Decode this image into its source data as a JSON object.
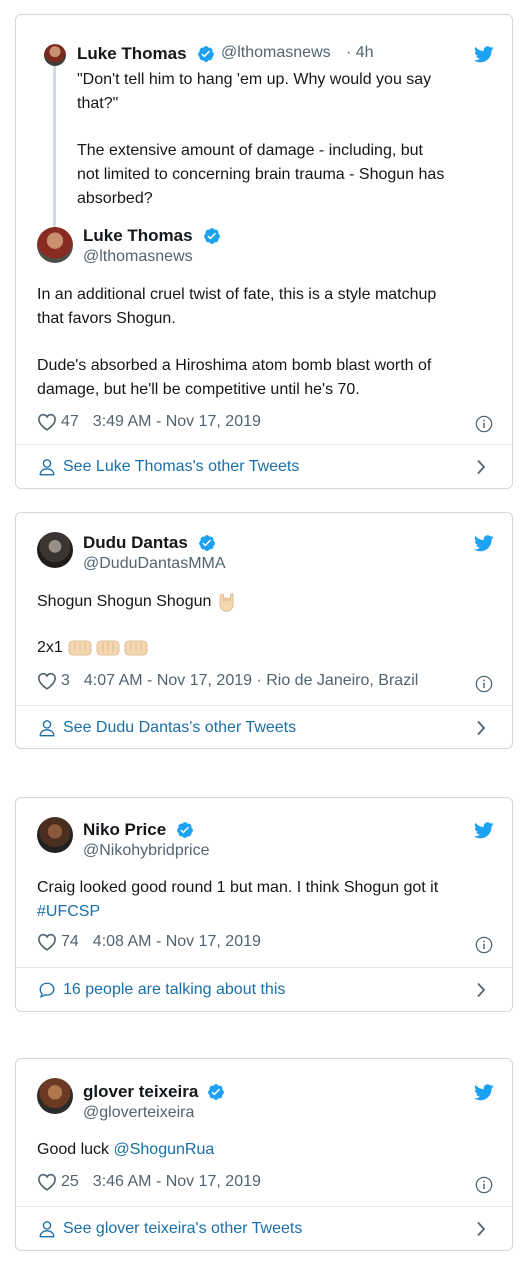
{
  "tweets": [
    {
      "quote": {
        "name": "Luke Thomas",
        "handle": "@lthomasnews",
        "time": "· 4h",
        "line1": "\"Don't tell him to hang 'em up. Why would you say",
        "line2": "that?\"",
        "line3": "The extensive amount of damage - including, but",
        "line4": "not limited to concerning brain trauma - Shogun has",
        "line5": "absorbed?"
      },
      "name": "Luke Thomas",
      "handle": "@lthomasnews",
      "line1": "In an additional cruel twist of fate, this is a style matchup",
      "line2": "that favors Shogun.",
      "line3": "Dude's absorbed a Hiroshima atom bomb blast worth of",
      "line4": "damage, but he'll be competitive until he's 70.",
      "likes": "47",
      "timestamp": "3:49 AM - Nov 17, 2019",
      "footer": "See Luke Thomas's other Tweets"
    },
    {
      "name": "Dudu Dantas",
      "handle": "@DuduDantasMMA",
      "line1": "Shogun Shogun Shogun",
      "line2": "2x1",
      "likes": "3",
      "timestamp": "4:07 AM - Nov 17, 2019 · Rio de Janeiro, Brazil",
      "footer": "See Dudu Dantas's other Tweets"
    },
    {
      "name": "Niko Price",
      "handle": "@Nikohybridprice",
      "line1": "Craig looked good round 1 but man. I think Shogun got it",
      "hashtag": "#UFCSP",
      "likes": "74",
      "timestamp": "4:08 AM - Nov 17, 2019",
      "footer": "16 people are talking about this"
    },
    {
      "name": "glover teixeira",
      "handle": "@gloverteixeira",
      "text_prefix": "Good luck ",
      "mention": "@ShogunRua",
      "likes": "25",
      "timestamp": "3:46 AM - Nov 17, 2019",
      "footer": "See glover teixeira's other Tweets"
    }
  ],
  "colors": {
    "twitter_blue": "#1da1f2",
    "link": "#1b6fa8",
    "muted": "#536471",
    "border": "#cfd9de"
  },
  "icons": [
    "twitter-bird-icon",
    "verified-badge-icon",
    "heart-icon",
    "info-icon",
    "person-icon",
    "speech-bubble-icon",
    "chevron-right-icon"
  ]
}
